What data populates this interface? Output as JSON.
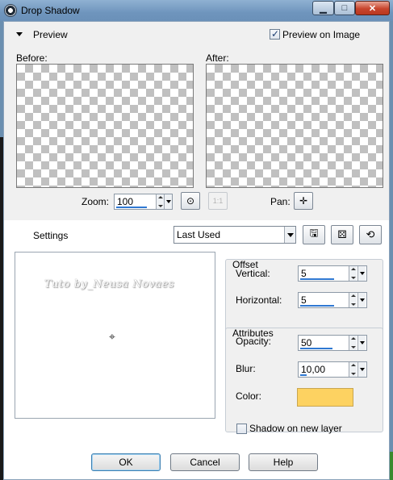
{
  "window": {
    "title": "Drop Shadow",
    "minimize_glyph": "▁",
    "maximize_glyph": "□",
    "close_glyph": "✕"
  },
  "preview": {
    "section_label": "Preview",
    "preview_on_image_label": "Preview on Image",
    "preview_on_image_checked": true,
    "before_label": "Before:",
    "after_label": "After:",
    "zoom_label": "Zoom:",
    "zoom_value": "100",
    "pan_label": "Pan:",
    "one_to_one_glyph": "1:1",
    "pan_glyph": "✛",
    "fit_glyph": "⊙"
  },
  "settings": {
    "label": "Settings",
    "preset_value": "Last Used",
    "save_icon": "save-icon",
    "randomize_icon": "dice-icon",
    "reset_icon": "reset-icon",
    "save_glyph": "🖫",
    "randomize_glyph": "⚄",
    "reset_glyph": "⟲"
  },
  "canvas": {
    "watermark": "Tuto by_Neusa Novaes",
    "crosshair_glyph": "⌖"
  },
  "offset": {
    "title": "Offset",
    "vertical_label": "Vertical:",
    "vertical_value": "5",
    "horizontal_label": "Horizontal:",
    "horizontal_value": "5"
  },
  "attributes": {
    "title": "Attributes",
    "opacity_label": "Opacity:",
    "opacity_value": "50",
    "blur_label": "Blur:",
    "blur_value": "10,00",
    "color_label": "Color:",
    "color_value": "#fdd261"
  },
  "shadow_on_new_layer": {
    "label": "Shadow on new layer",
    "checked": false
  },
  "buttons": {
    "ok": "OK",
    "cancel": "Cancel",
    "help": "Help"
  }
}
